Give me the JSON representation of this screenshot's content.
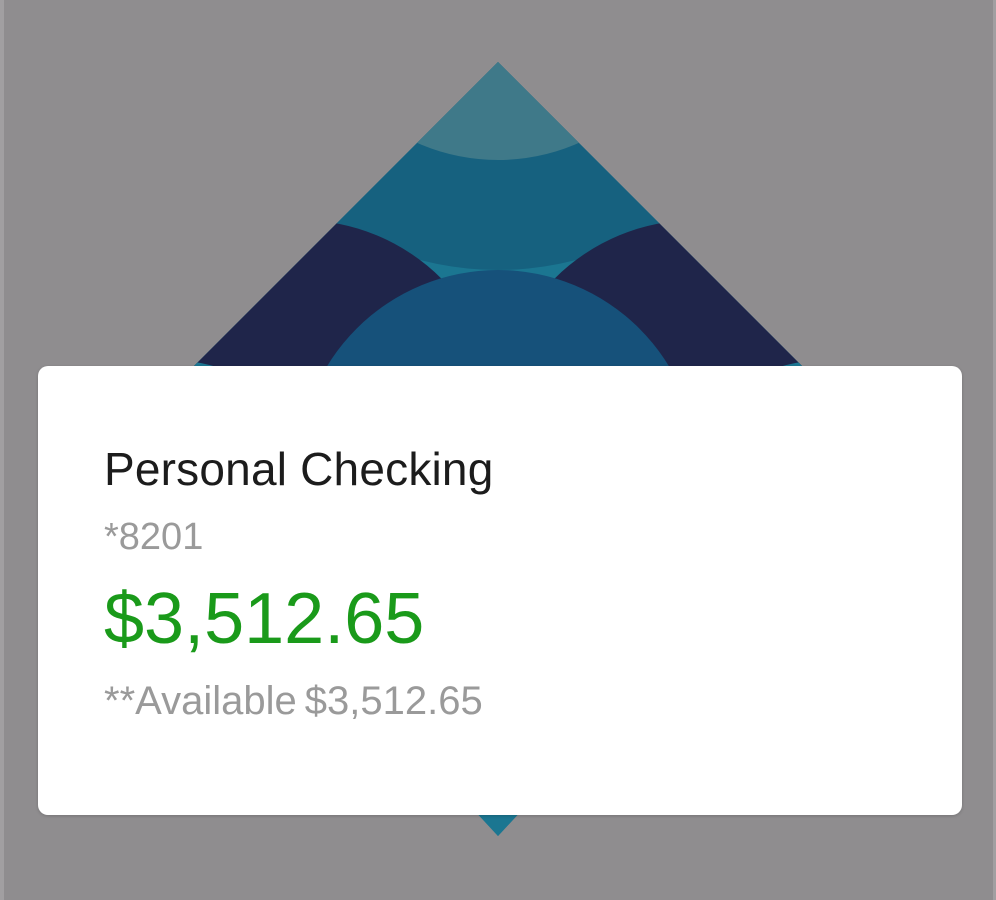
{
  "account": {
    "name": "Personal Checking",
    "masked_number": "*8201",
    "balance": "$3,512.65",
    "available_label": "**Available",
    "available_value": "$3,512.65"
  },
  "colors": {
    "background": "#8f8d8f",
    "balance_green": "#1a9a1a",
    "logo_teal": "#16617f",
    "logo_navy": "#1f254a"
  },
  "icons": {
    "logo": "bank-diamond-logo"
  }
}
